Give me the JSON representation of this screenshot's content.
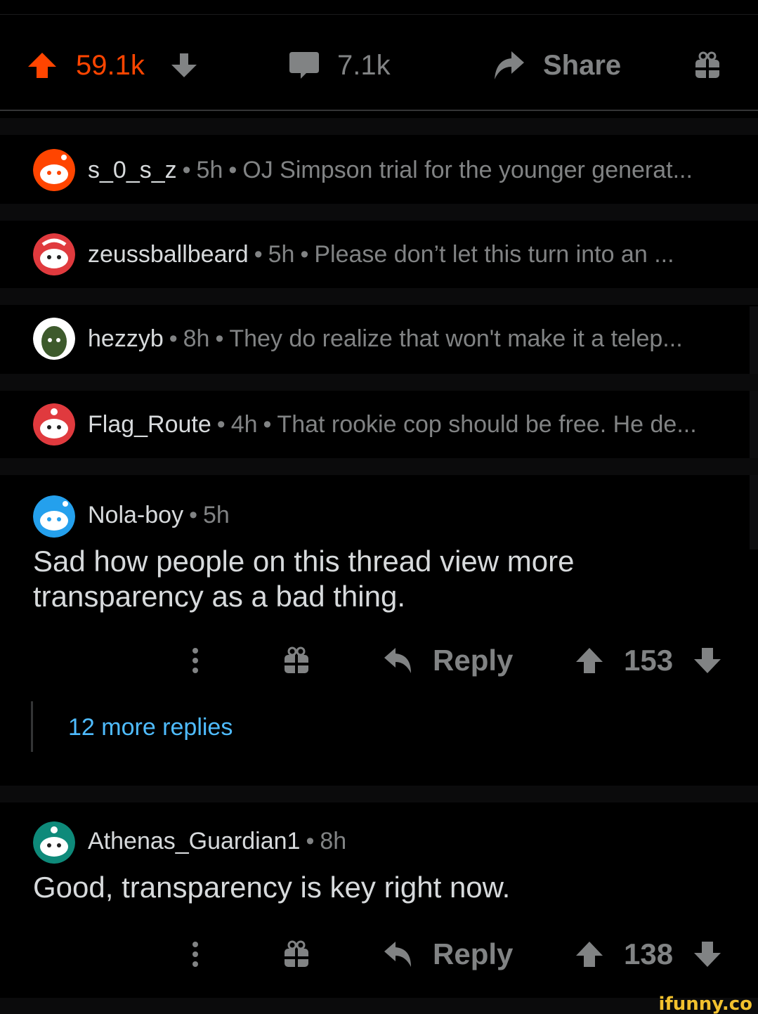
{
  "post_bar": {
    "score": "59.1k",
    "comments": "7.1k",
    "share_label": "Share",
    "score_color": "#ff4500",
    "icons": [
      "arrow-up-icon",
      "arrow-down-icon",
      "comment-bubble-icon",
      "share-arrow-icon",
      "gift-icon"
    ]
  },
  "collapsed_comments": [
    {
      "user": "s_0_s_z",
      "time": "5h",
      "snippet": "OJ Simpson trial for the younger generat..."
    },
    {
      "user": "zeussballbeard",
      "time": "5h",
      "snippet": "Please don’t let this turn into an ..."
    },
    {
      "user": "hezzyb",
      "time": "8h",
      "snippet": "They do realize that won't make it a telep..."
    },
    {
      "user": "Flag_Route",
      "time": "4h",
      "snippet": "That rookie cop should be free. He de..."
    }
  ],
  "comments": [
    {
      "user": "Nola-boy",
      "time": "5h",
      "line1": "Sad how people on this thread view more",
      "line2": "transparency as a bad thing.",
      "reply_label": "Reply",
      "score": "153"
    },
    {
      "user": "Athenas_Guardian1",
      "time": "8h",
      "line1": "Good, transparency is key right now.",
      "reply_label": "Reply",
      "score": "138"
    }
  ],
  "more_replies": "12 more replies",
  "watermark": "ifunny.co",
  "colors": {
    "background": "#000000",
    "muted": "#818384",
    "link": "#4fbcff",
    "upvote_active": "#ff4500"
  }
}
